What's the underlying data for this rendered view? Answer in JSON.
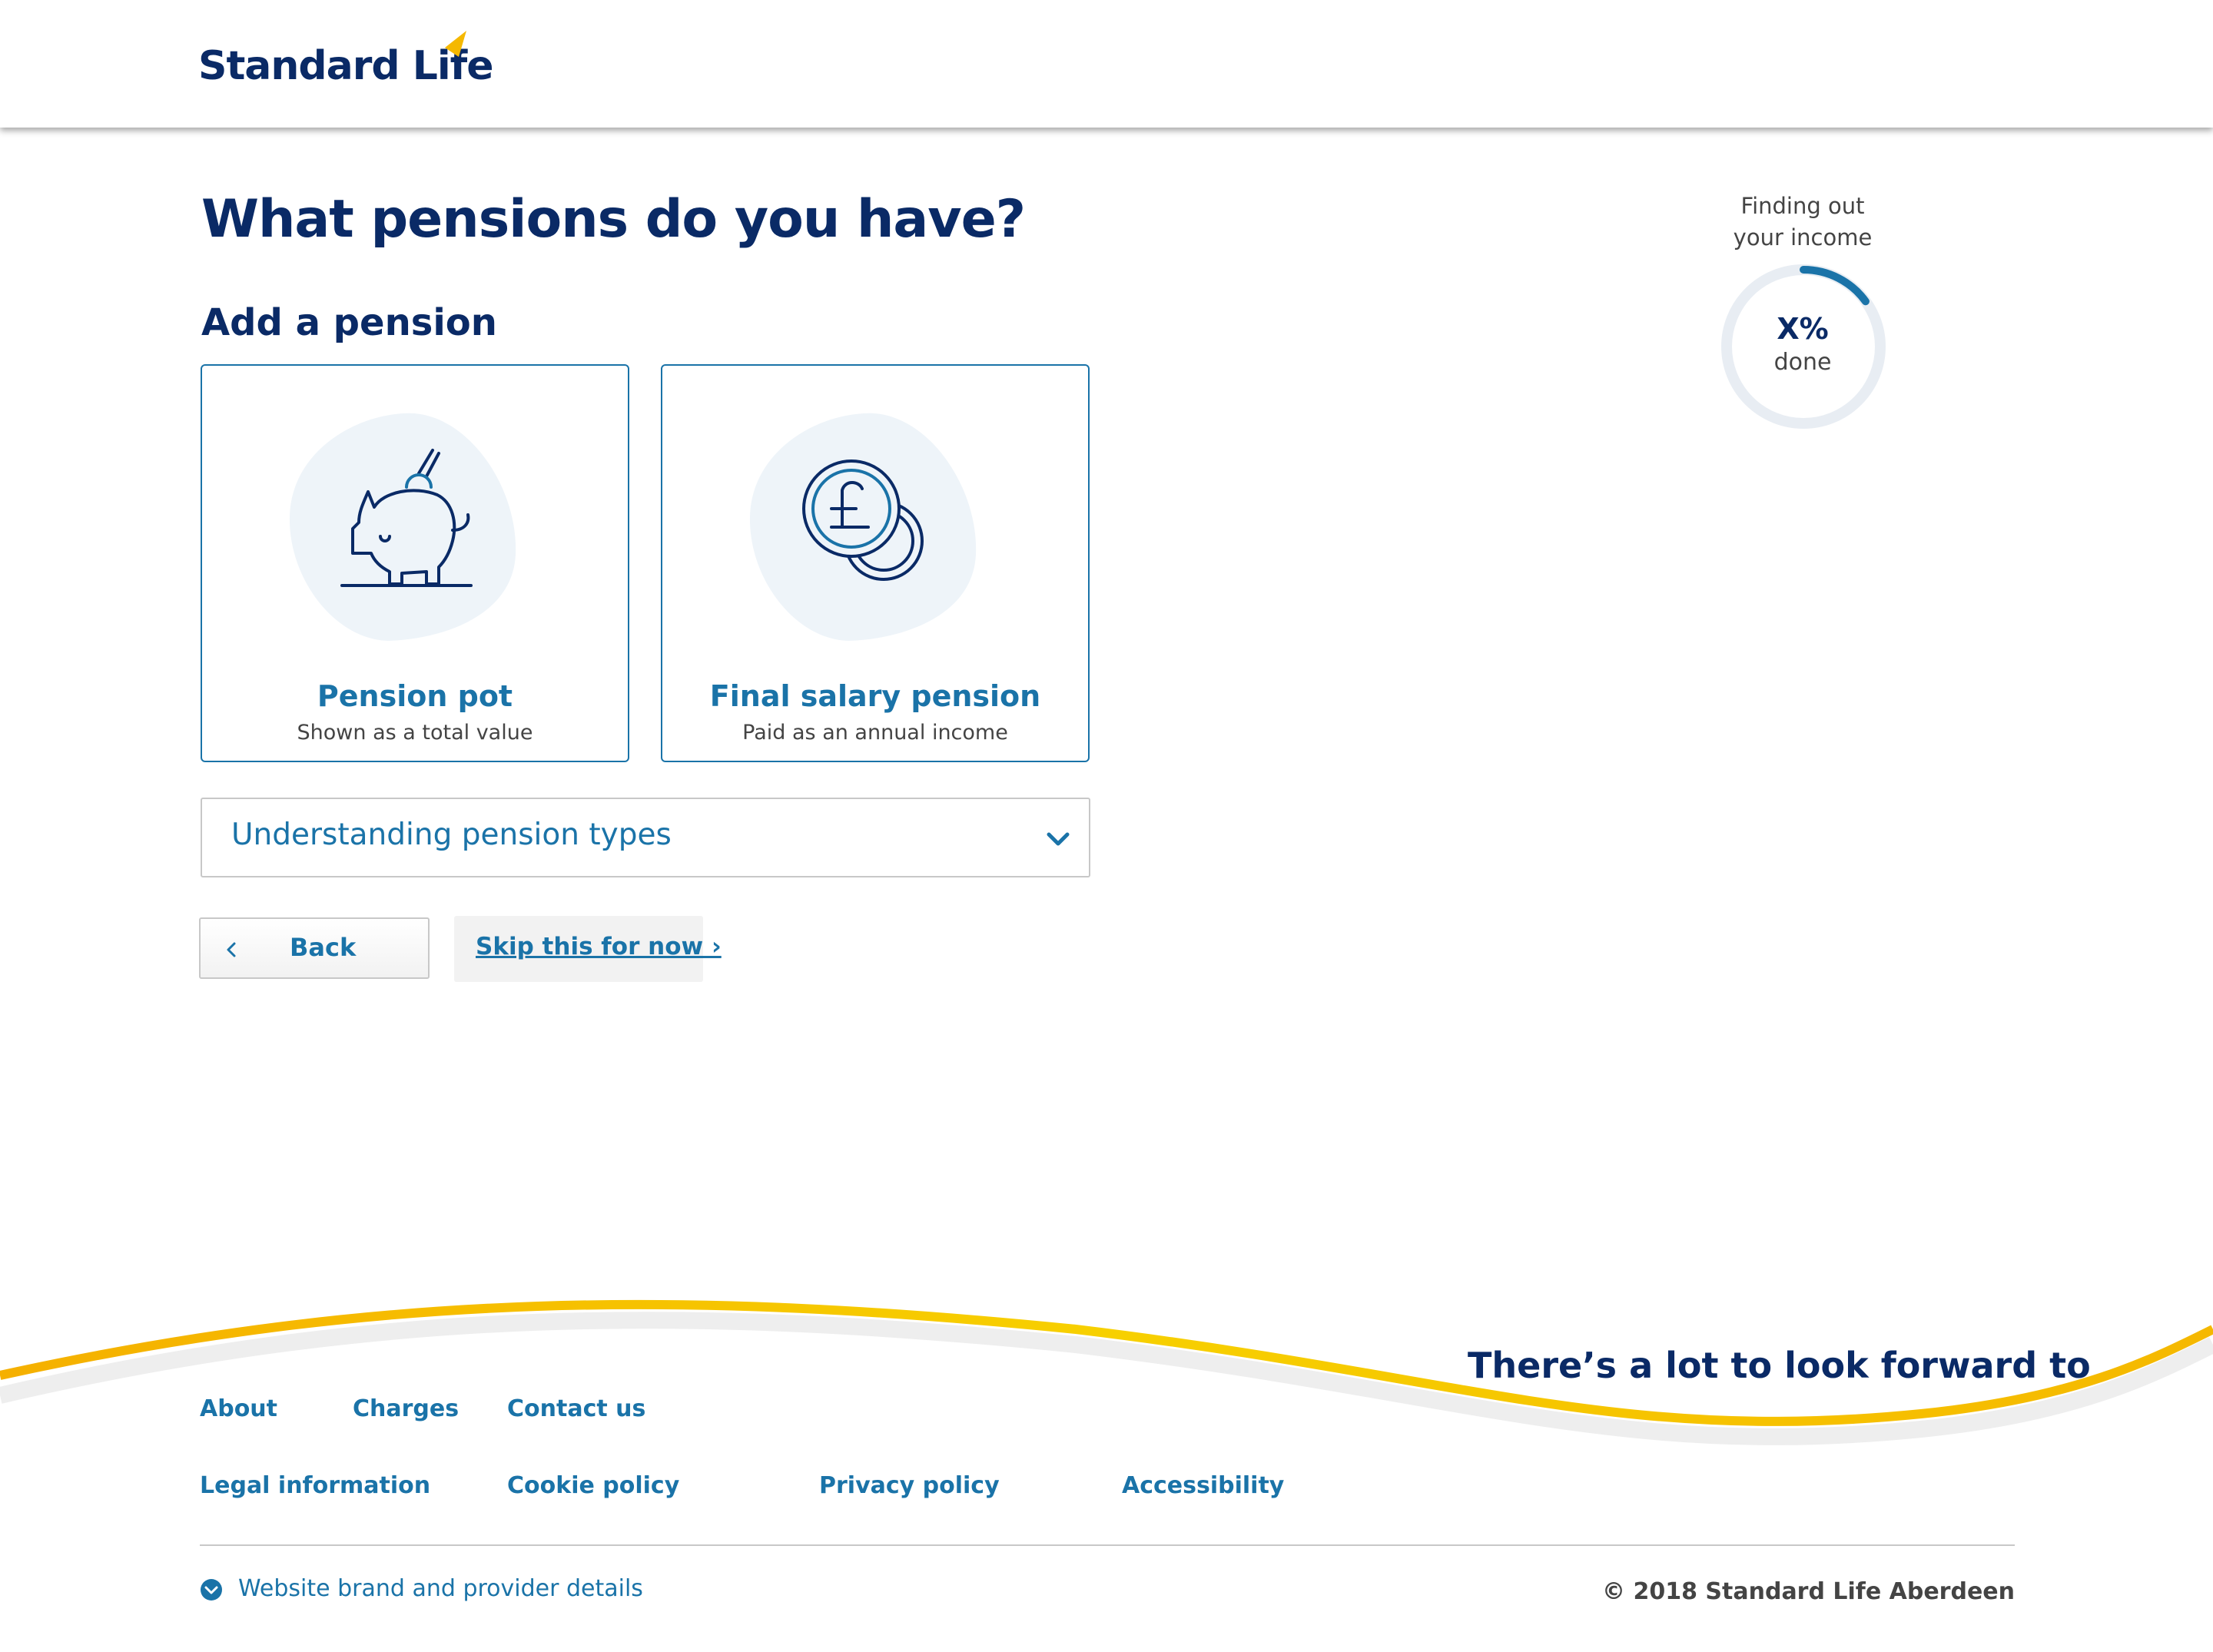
{
  "header": {
    "brand": "Standard Life",
    "brand_accent": "#f5b800"
  },
  "main": {
    "title": "What pensions do you have?",
    "section_title": "Add a pension",
    "cards": [
      {
        "title": "Pension pot",
        "subtitle": "Shown as a total value",
        "icon": "piggy-bank-icon"
      },
      {
        "title": "Final salary pension",
        "subtitle": "Paid as an annual income",
        "icon": "pound-coin-icon"
      }
    ],
    "accordion": {
      "label": "Understanding pension types",
      "icon": "chevron-down-icon"
    },
    "buttons": {
      "back_label": "Back",
      "skip_label": "Skip this for now ›"
    }
  },
  "progress": {
    "label": "Finding out your income",
    "value": "X%",
    "unit": "done",
    "ring_fill_fraction": 0.15
  },
  "footer": {
    "tagline": "There’s a lot to look forward to",
    "links_row1": [
      "About",
      "Charges",
      "Contact us"
    ],
    "links_row2": [
      "Legal information",
      "Cookie policy",
      "Privacy policy",
      "Accessibility"
    ],
    "provider_label": "Website brand and provider details",
    "copyright": "© 2018 Standard Life Aberdeen"
  },
  "colors": {
    "navy": "#0a2a66",
    "link_blue": "#1a73a8",
    "wave_yellow": "#f5c400",
    "ring_track": "#e8edf3"
  }
}
